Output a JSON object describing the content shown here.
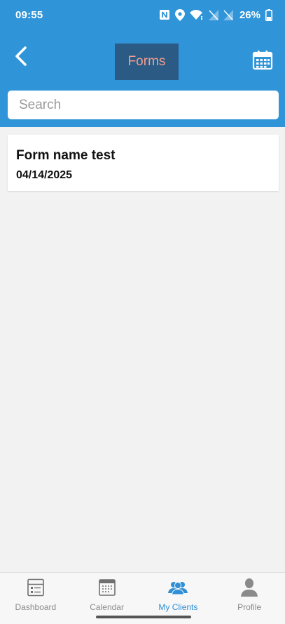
{
  "status_bar": {
    "time": "09:55",
    "battery": "26%"
  },
  "header": {
    "title": "Forms",
    "back_icon": "chevron-left-icon",
    "calendar_icon": "calendar-icon"
  },
  "search": {
    "placeholder": "Search",
    "value": ""
  },
  "forms": [
    {
      "name": "Form name test",
      "date": "04/14/2025"
    }
  ],
  "bottom_nav": {
    "items": [
      {
        "label": "Dashboard",
        "icon": "dashboard-icon",
        "active": false
      },
      {
        "label": "Calendar",
        "icon": "calendar-icon",
        "active": false
      },
      {
        "label": "My Clients",
        "icon": "clients-icon",
        "active": true
      },
      {
        "label": "Profile",
        "icon": "profile-icon",
        "active": false
      }
    ]
  },
  "colors": {
    "header_bg": "#2f94d8",
    "title_box_bg": "#2b5b84",
    "title_text": "#f49c8e",
    "active_nav": "#2f8fd6",
    "page_bg": "#f2f2f2"
  }
}
